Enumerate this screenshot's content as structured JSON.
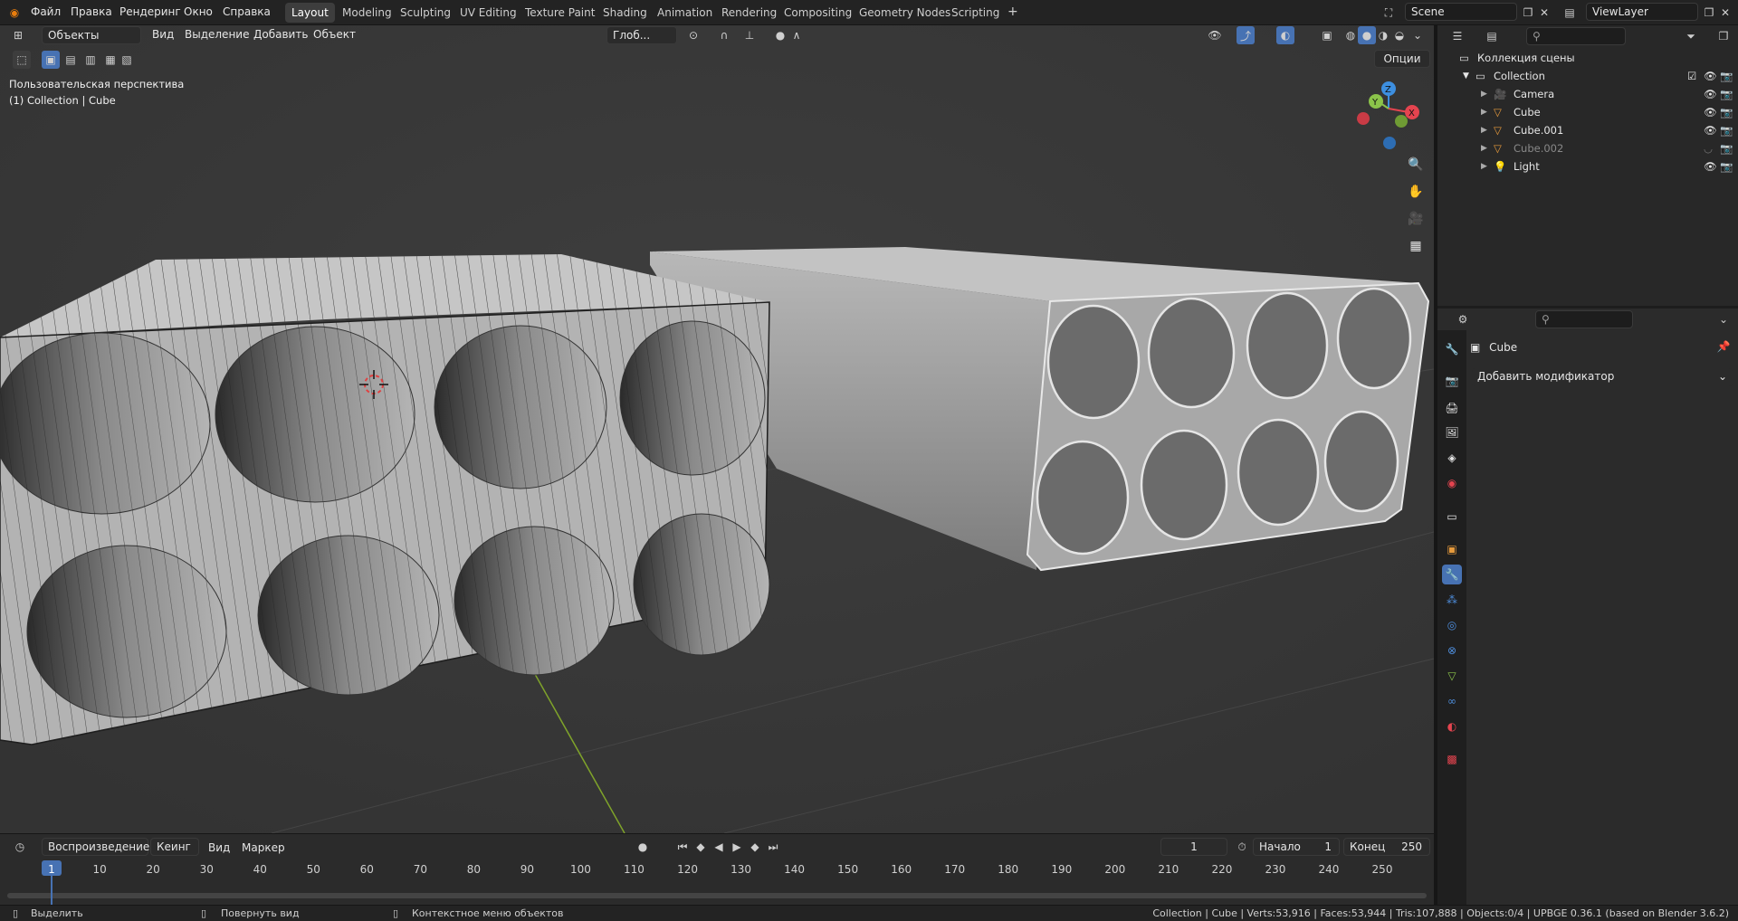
{
  "topbar": {
    "menus": [
      "Файл",
      "Правка",
      "Рендеринг",
      "Окно",
      "Справка"
    ],
    "workspaces": [
      "Layout",
      "Modeling",
      "Sculpting",
      "UV Editing",
      "Texture Paint",
      "Shading",
      "Animation",
      "Rendering",
      "Compositing",
      "Geometry Nodes",
      "Scripting"
    ],
    "active_workspace": "Layout",
    "add_workspace": "+",
    "scene": "Scene",
    "view_layer": "ViewLayer"
  },
  "viewport_header": {
    "mode": "Объекты",
    "menus": [
      "Вид",
      "Выделение",
      "Добавить",
      "Объект"
    ],
    "orientation": "Глоб...",
    "options": "Опции"
  },
  "viewport_overlay": {
    "view_name": "Пользовательская перспектива",
    "collection_line": "(1) Collection | Cube",
    "gizmo": {
      "x": "X",
      "y": "Y",
      "z": "Z"
    }
  },
  "outliner": {
    "root": "Коллекция сцены",
    "collection": "Collection",
    "items": [
      {
        "name": "Camera",
        "icon": "camera-icon",
        "dim": false
      },
      {
        "name": "Cube",
        "icon": "mesh-icon",
        "dim": false
      },
      {
        "name": "Cube.001",
        "icon": "mesh-icon",
        "dim": false
      },
      {
        "name": "Cube.002",
        "icon": "mesh-icon",
        "dim": true
      },
      {
        "name": "Light",
        "icon": "light-icon",
        "dim": false
      }
    ]
  },
  "properties": {
    "object_name": "Cube",
    "add_modifier": "Добавить модификатор"
  },
  "timeline": {
    "menus": [
      "Воспроизведение",
      "Кеинг",
      "Вид",
      "Маркер"
    ],
    "current_frame": "1",
    "start_label": "Начало",
    "start": "1",
    "end_label": "Конец",
    "end": "250",
    "ticks": [
      "1",
      "10",
      "20",
      "30",
      "40",
      "50",
      "60",
      "70",
      "80",
      "90",
      "100",
      "110",
      "120",
      "130",
      "140",
      "150",
      "160",
      "170",
      "180",
      "190",
      "200",
      "210",
      "220",
      "230",
      "240",
      "250"
    ]
  },
  "status": {
    "select": "Выделить",
    "rotate": "Повернуть вид",
    "context": "Контекстное меню объектов",
    "stats": "Collection | Cube | Verts:53,916 | Faces:53,944 | Tris:107,888 | Objects:0/4 | UPBGE 0.36.1 (based on Blender 3.6.2)"
  },
  "colors": {
    "accent": "#4772b3",
    "axis_x": "#e5444f",
    "axis_y": "#8bc34a",
    "axis_z": "#3d8fe0",
    "mesh_orange": "#e69a3c",
    "modifier_blue": "#4e8ddb"
  }
}
